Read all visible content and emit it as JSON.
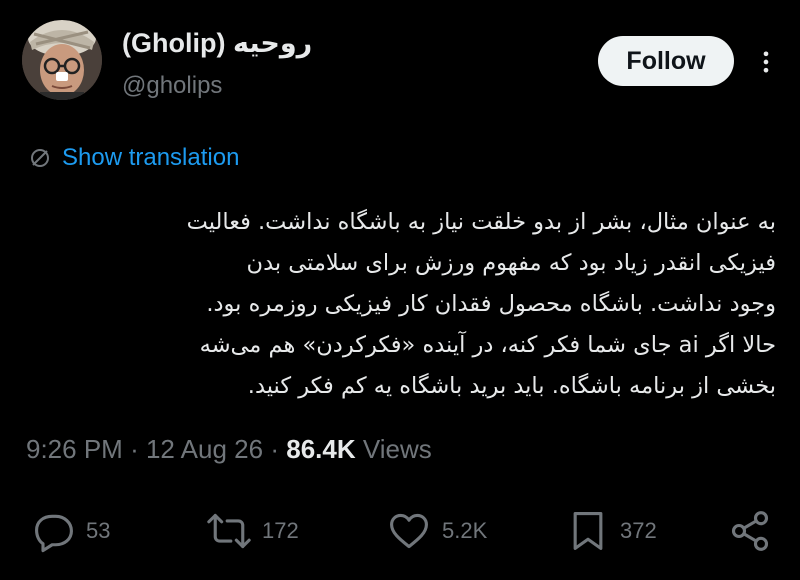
{
  "author": {
    "display_name": "(Gholip) روحیه",
    "handle": "@gholips",
    "avatar_icon": "avatar-photo"
  },
  "follow_label": "Follow",
  "more_icon": "more-options-icon",
  "translation": {
    "icon": "translate-icon",
    "label": "Show translation"
  },
  "tweet": {
    "lines": [
      "به عنوان مثال، بشر از بدو خلقت نیاز به باشگاه نداشت. فعالیت",
      "فیزیکی انقدر زیاد بود که مفهوم ورزش برای سلامتی بدن",
      "وجود نداشت. باشگاه محصول فقدان کار فیزیکی روزمره بود.",
      "حالا اگر ai جای شما فکر کنه، در آینده «فکرکردن» هم می‌شه",
      "بخشی از برنامه باشگاه. باید برید باشگاه یه کم فکر کنید."
    ]
  },
  "meta": {
    "time": "9:26 PM",
    "separator": "·",
    "date": "12 Aug 26",
    "views_count": "86.4K",
    "views_label": "Views"
  },
  "actions": {
    "replies": "53",
    "reposts": "172",
    "likes": "5.2K",
    "bookmarks": "372"
  },
  "colors": {
    "background": "#000000",
    "text": "#e7e9ea",
    "secondary": "#71767b",
    "link": "#1d9bf0",
    "follow_bg": "#eff3f4"
  }
}
